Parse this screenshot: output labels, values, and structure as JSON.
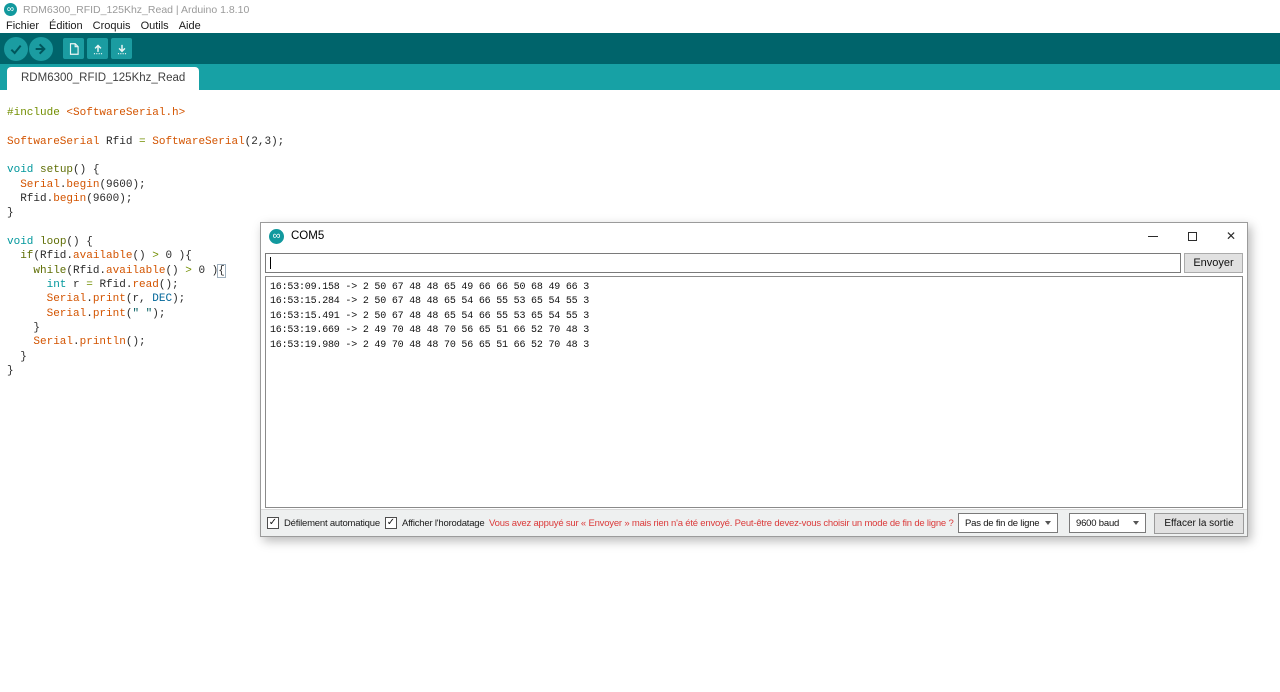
{
  "ide": {
    "title": "RDM6300_RFID_125Khz_Read | Arduino 1.8.10",
    "menus": [
      "Fichier",
      "Édition",
      "Croquis",
      "Outils",
      "Aide"
    ],
    "toolbar_buttons": [
      "verify",
      "upload",
      "new-sketch",
      "open-sketch",
      "save-sketch"
    ],
    "active_tab": "RDM6300_RFID_125Khz_Read"
  },
  "editor": {
    "lines": [
      [
        {
          "t": "#include ",
          "c": "pre"
        },
        {
          "t": "<SoftwareSerial.h>",
          "c": "fn"
        }
      ],
      [],
      [
        {
          "t": "SoftwareSerial",
          "c": "fn"
        },
        {
          "t": " Rfid ",
          "c": "pl"
        },
        {
          "t": "=",
          "c": "op"
        },
        {
          "t": " ",
          "c": "pl"
        },
        {
          "t": "SoftwareSerial",
          "c": "fn"
        },
        {
          "t": "(2,3);",
          "c": "pl"
        }
      ],
      [],
      [
        {
          "t": "void",
          "c": "type"
        },
        {
          "t": " ",
          "c": "pl"
        },
        {
          "t": "setup",
          "c": "kw"
        },
        {
          "t": "() {",
          "c": "pl"
        }
      ],
      [
        {
          "t": "  ",
          "c": "pl"
        },
        {
          "t": "Serial",
          "c": "fn"
        },
        {
          "t": ".",
          "c": "pl"
        },
        {
          "t": "begin",
          "c": "fn"
        },
        {
          "t": "(9600);",
          "c": "pl"
        }
      ],
      [
        {
          "t": "  Rfid.",
          "c": "pl"
        },
        {
          "t": "begin",
          "c": "fn"
        },
        {
          "t": "(9600);",
          "c": "pl"
        }
      ],
      [
        {
          "t": "}",
          "c": "pl"
        }
      ],
      [],
      [
        {
          "t": "void",
          "c": "type"
        },
        {
          "t": " ",
          "c": "pl"
        },
        {
          "t": "loop",
          "c": "kw"
        },
        {
          "t": "() {",
          "c": "pl"
        }
      ],
      [
        {
          "t": "  ",
          "c": "pl"
        },
        {
          "t": "if",
          "c": "kw"
        },
        {
          "t": "(Rfid.",
          "c": "pl"
        },
        {
          "t": "available",
          "c": "fn"
        },
        {
          "t": "() ",
          "c": "pl"
        },
        {
          "t": ">",
          "c": "op"
        },
        {
          "t": " 0 ){",
          "c": "pl"
        }
      ],
      [
        {
          "t": "    ",
          "c": "pl"
        },
        {
          "t": "while",
          "c": "kw"
        },
        {
          "t": "(Rfid.",
          "c": "pl"
        },
        {
          "t": "available",
          "c": "fn"
        },
        {
          "t": "() ",
          "c": "pl"
        },
        {
          "t": ">",
          "c": "op"
        },
        {
          "t": " 0 )",
          "c": "pl"
        },
        {
          "t": "{",
          "c": "hl"
        }
      ],
      [
        {
          "t": "      ",
          "c": "pl"
        },
        {
          "t": "int",
          "c": "type"
        },
        {
          "t": " r ",
          "c": "pl"
        },
        {
          "t": "=",
          "c": "op"
        },
        {
          "t": " Rfid.",
          "c": "pl"
        },
        {
          "t": "read",
          "c": "fn"
        },
        {
          "t": "();",
          "c": "pl"
        }
      ],
      [
        {
          "t": "      ",
          "c": "pl"
        },
        {
          "t": "Serial",
          "c": "fn"
        },
        {
          "t": ".",
          "c": "pl"
        },
        {
          "t": "print",
          "c": "fn"
        },
        {
          "t": "(r, ",
          "c": "pl"
        },
        {
          "t": "DEC",
          "c": "lit"
        },
        {
          "t": ");",
          "c": "pl"
        }
      ],
      [
        {
          "t": "      ",
          "c": "pl"
        },
        {
          "t": "Serial",
          "c": "fn"
        },
        {
          "t": ".",
          "c": "pl"
        },
        {
          "t": "print",
          "c": "fn"
        },
        {
          "t": "(",
          "c": "pl"
        },
        {
          "t": "\" \"",
          "c": "str"
        },
        {
          "t": ");",
          "c": "pl"
        }
      ],
      [
        {
          "t": "    }",
          "c": "pl"
        }
      ],
      [
        {
          "t": "    ",
          "c": "pl"
        },
        {
          "t": "Serial",
          "c": "fn"
        },
        {
          "t": ".",
          "c": "pl"
        },
        {
          "t": "println",
          "c": "fn"
        },
        {
          "t": "();",
          "c": "pl"
        }
      ],
      [
        {
          "t": "  }",
          "c": "pl"
        }
      ],
      [
        {
          "t": "}",
          "c": "pl"
        }
      ]
    ]
  },
  "serial_monitor": {
    "title": "COM5",
    "input_value": "",
    "send_button": "Envoyer",
    "output_lines": [
      "16:53:09.158 -> 2 50 67 48 48 65 49 66 66 50 68 49 66 3",
      "16:53:15.284 -> 2 50 67 48 48 65 54 66 55 53 65 54 55 3",
      "16:53:15.491 -> 2 50 67 48 48 65 54 66 55 53 65 54 55 3",
      "16:53:19.669 -> 2 49 70 48 48 70 56 65 51 66 52 70 48 3",
      "16:53:19.980 -> 2 49 70 48 48 70 56 65 51 66 52 70 48 3"
    ],
    "autoscroll_label": "Défilement automatique",
    "autoscroll_checked": true,
    "timestamp_label": "Afficher l'horodatage",
    "timestamp_checked": true,
    "warning": "Vous avez appuyé sur « Envoyer » mais rien n'a été envoyé. Peut-être devez-vous choisir un mode de fin de ligne ?",
    "line_ending_value": "Pas de fin de ligne",
    "baud_value": "9600 baud",
    "clear_button": "Effacer la sortie",
    "check_glyph": "✓"
  },
  "glyphs": {
    "arduino_logo": "∞",
    "close": "✕"
  },
  "colors": {
    "toolbar_teal": "#00646B",
    "tabstrip_teal": "#17A1A5",
    "button_teal": "#1B9CA1",
    "warning_red": "#DB3A3A",
    "token_type": "#00979C",
    "token_keyword": "#5E6D03",
    "token_function": "#D35400",
    "token_literal": "#006699",
    "token_string": "#005C5F",
    "token_operator": "#728E00"
  }
}
